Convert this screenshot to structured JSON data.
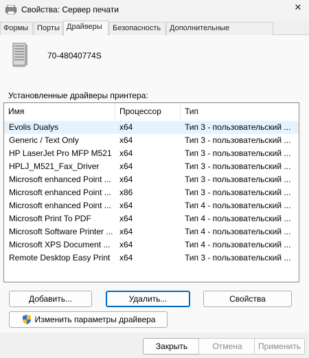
{
  "window": {
    "title": "Свойства: Сервер печати",
    "close_glyph": "✕"
  },
  "tabs": [
    {
      "label": "Формы"
    },
    {
      "label": "Порты"
    },
    {
      "label": "Драйверы"
    },
    {
      "label": "Безопасность"
    },
    {
      "label": "Дополнительные параметры"
    }
  ],
  "server": {
    "name": "70-48040774S",
    "icon": "server-tower-icon"
  },
  "drivers": {
    "label": "Установленные драйверы принтера:",
    "columns": [
      "Имя",
      "Процессор",
      "Тип"
    ],
    "rows": [
      {
        "name": "Evolis Dualys",
        "processor": "x64",
        "type": "Тип 3 - пользовательский ..."
      },
      {
        "name": "Generic / Text Only",
        "processor": "x64",
        "type": "Тип 3 - пользовательский ..."
      },
      {
        "name": "HP LaserJet Pro MFP M521 ...",
        "processor": "x64",
        "type": "Тип 3 - пользовательский ..."
      },
      {
        "name": "HPLJ_M521_Fax_Driver",
        "processor": "x64",
        "type": "Тип 3 - пользовательский ..."
      },
      {
        "name": "Microsoft enhanced Point ...",
        "processor": "x64",
        "type": "Тип 3 - пользовательский ..."
      },
      {
        "name": "Microsoft enhanced Point ...",
        "processor": "x86",
        "type": "Тип 3 - пользовательский ..."
      },
      {
        "name": "Microsoft enhanced Point ...",
        "processor": "x64",
        "type": "Тип 4 - пользовательский ..."
      },
      {
        "name": "Microsoft Print To PDF",
        "processor": "x64",
        "type": "Тип 4 - пользовательский ..."
      },
      {
        "name": "Microsoft Software Printer ...",
        "processor": "x64",
        "type": "Тип 4 - пользовательский ..."
      },
      {
        "name": "Microsoft XPS Document ...",
        "processor": "x64",
        "type": "Тип 4 - пользовательский ..."
      },
      {
        "name": "Remote Desktop Easy Print",
        "processor": "x64",
        "type": "Тип 3 - пользовательский ..."
      }
    ]
  },
  "buttons": {
    "add": "Добавить...",
    "remove": "Удалить...",
    "properties": "Свойства",
    "change_driver_settings": "Изменить параметры драйвера",
    "ok": "Закрыть",
    "cancel": "Отмена",
    "apply": "Применить"
  },
  "colors": {
    "selected_row": "#e5f3ff",
    "focus_border": "#0067c0"
  }
}
